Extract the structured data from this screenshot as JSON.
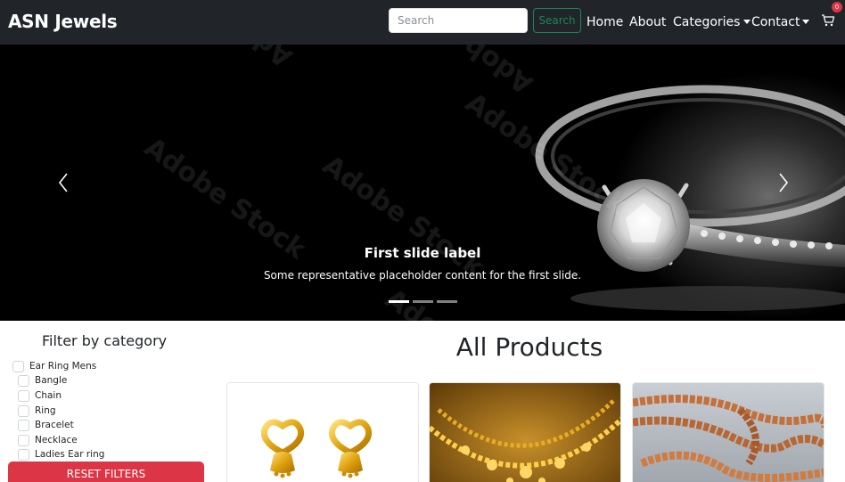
{
  "navbar": {
    "brand": "ASN Jewels",
    "search": {
      "placeholder": "Search",
      "value": "",
      "button_label": "Search"
    },
    "links": {
      "home": "Home",
      "about": "About",
      "categories": "Categories",
      "contact": "Contact"
    },
    "cart_badge": "0",
    "icons": {
      "cart": "cart-icon",
      "dropdown": "chevron-down-icon"
    }
  },
  "carousel": {
    "slide_title": "First slide label",
    "slide_text": "Some representative placeholder content for the first slide.",
    "indicators": 3,
    "active_index": 0,
    "watermark": "Adobe Stock"
  },
  "filter": {
    "title": "Filter by category",
    "categories": [
      "Ear Ring Mens",
      "Bangle",
      "Chain",
      "Ring",
      "Bracelet",
      "Necklace",
      "Ladies Ear ring"
    ],
    "reset_label": "RESET FILTERS"
  },
  "products": {
    "title": "All Products",
    "cards": [
      {
        "image": "gold-earrings-image"
      },
      {
        "image": "gold-necklace-image"
      },
      {
        "image": "gold-chain-image"
      }
    ]
  },
  "colors": {
    "navbar_bg": "#212529",
    "search_button": "#198754",
    "reset_button": "#dc3545",
    "badge": "#dc3545"
  }
}
